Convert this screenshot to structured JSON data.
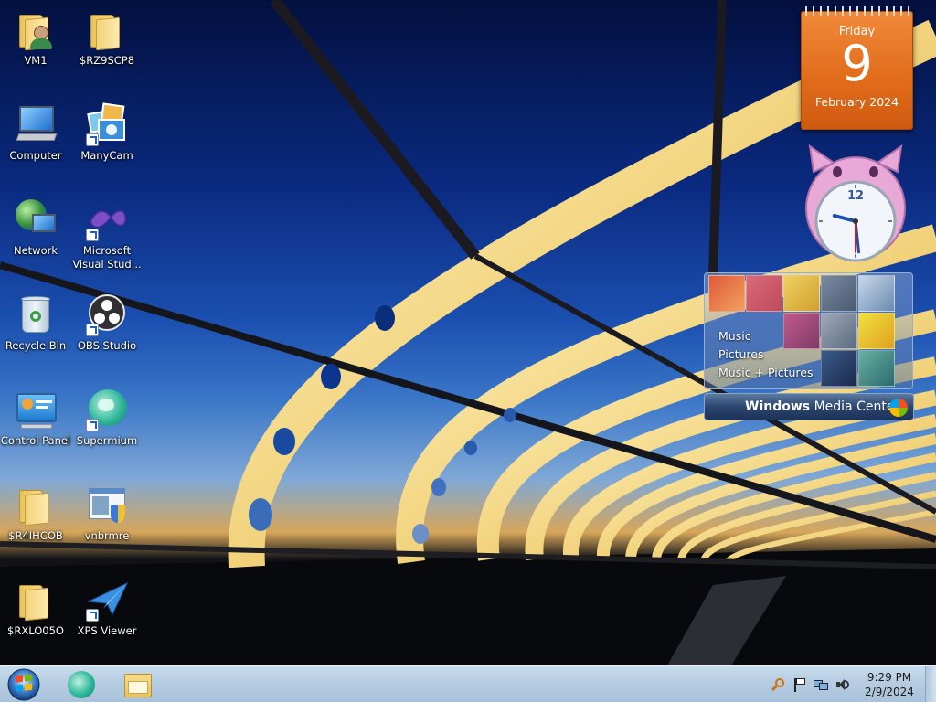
{
  "desktop": {
    "icons": [
      {
        "label": "VM1",
        "icon": "user-folder-icon"
      },
      {
        "label": "$RZ9SCP8",
        "icon": "folder-icon"
      },
      {
        "label": "Computer",
        "icon": "computer-icon"
      },
      {
        "label": "ManyCam",
        "icon": "manycam-icon"
      },
      {
        "label": "Network",
        "icon": "network-icon"
      },
      {
        "label": "Microsoft Visual Stud...",
        "icon": "visual-studio-icon"
      },
      {
        "label": "Recycle Bin",
        "icon": "recycle-bin-icon"
      },
      {
        "label": "OBS Studio",
        "icon": "obs-studio-icon"
      },
      {
        "label": "Control Panel",
        "icon": "control-panel-icon"
      },
      {
        "label": "Supermium",
        "icon": "supermium-icon"
      },
      {
        "label": "$R4IHCOB",
        "icon": "folder-icon"
      },
      {
        "label": "vnbrmre",
        "icon": "installer-icon"
      },
      {
        "label": "$RXLO05O",
        "icon": "folder-icon"
      },
      {
        "label": "XPS Viewer",
        "icon": "xps-viewer-icon"
      }
    ]
  },
  "gadgets": {
    "calendar": {
      "day_of_week": "Friday",
      "day": "9",
      "month_year": "February 2024"
    },
    "clock": {
      "numeral_12": "12",
      "hour_value": 9,
      "minute_value": 29
    },
    "media_center": {
      "menu": [
        "Music",
        "Pictures",
        "Music + Pictures"
      ],
      "title_bold": "Windows",
      "title_rest": " Media Center"
    }
  },
  "taskbar": {
    "start_icon": "windows-start-orb-icon",
    "pinned": [
      {
        "name": "supermium-taskbar",
        "icon": "supermium-icon"
      },
      {
        "name": "explorer-taskbar",
        "icon": "file-explorer-icon"
      }
    ],
    "tray_icons": [
      "search-icon",
      "action-center-flag-icon",
      "network-icon",
      "volume-icon"
    ],
    "time": "9:29 PM",
    "date": "2/9/2024"
  },
  "colors": {
    "taskbar": "#b7cde2",
    "calendar": "#e06b1a",
    "folder": "#f3d37a"
  }
}
